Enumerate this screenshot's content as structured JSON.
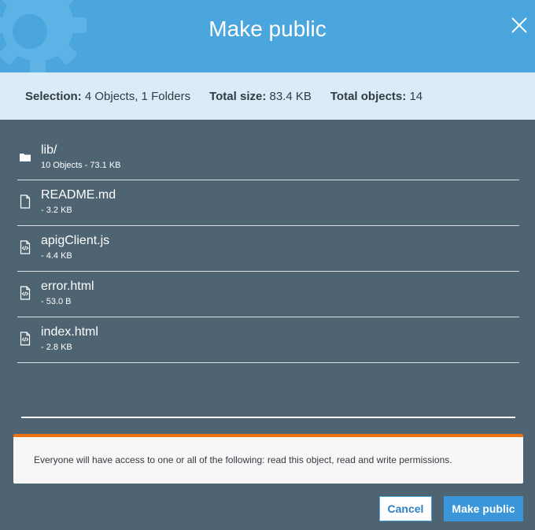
{
  "dialog": {
    "title": "Make public",
    "close_icon": "close-icon"
  },
  "summary": {
    "selection_label": "Selection:",
    "selection_value": "4 Objects, 1 Folders",
    "size_label": "Total size:",
    "size_value": "83.4 KB",
    "objects_label": "Total objects:",
    "objects_value": "14"
  },
  "items": [
    {
      "name": "lib/",
      "meta": "10 Objects - 73.1 KB",
      "icon": "folder-icon"
    },
    {
      "name": "README.md",
      "meta": "- 3.2 KB",
      "icon": "file-icon"
    },
    {
      "name": "apigClient.js",
      "meta": "- 4.4 KB",
      "icon": "code-file-icon"
    },
    {
      "name": "error.html",
      "meta": "- 53.0 B",
      "icon": "code-file-icon"
    },
    {
      "name": "index.html",
      "meta": "- 2.8 KB",
      "icon": "code-file-icon"
    }
  ],
  "warning": {
    "text": "Everyone will have access to one or all of the following: read this object, read and write permissions."
  },
  "buttons": {
    "cancel": "Cancel",
    "confirm": "Make public"
  },
  "colors": {
    "header": "#4aa6dd",
    "body": "#4f6472",
    "summary_bg": "#d9ecf7",
    "warning_accent": "#ec7211",
    "primary_button": "#3b95d9"
  }
}
